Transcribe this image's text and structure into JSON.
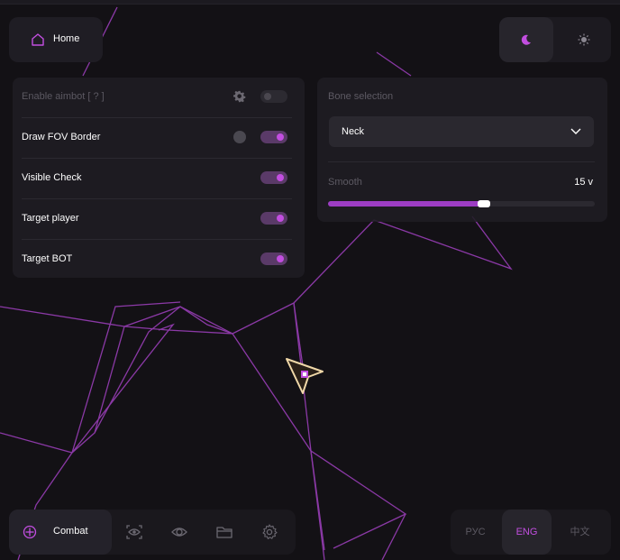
{
  "colors": {
    "accent": "#c24ee0",
    "background": "#131115",
    "panel": "#1f1d23"
  },
  "header": {
    "home_label": "Home",
    "home_icon": "home-icon",
    "theme_icons": [
      "moon-icon",
      "sun-icon"
    ],
    "active_theme": "dark"
  },
  "aimbot_panel": {
    "rows": [
      {
        "label": "Enable aimbot  [ ? ]",
        "enabled": false,
        "has_settings": true
      },
      {
        "label": "Draw FOV Border",
        "enabled": true,
        "has_color": true
      },
      {
        "label": "Visible Check",
        "enabled": true
      },
      {
        "label": "Target player",
        "enabled": true
      },
      {
        "label": "Target BOT",
        "enabled": true
      }
    ]
  },
  "bone_panel": {
    "title": "Bone selection",
    "selected": "Neck",
    "smooth_label": "Smooth",
    "smooth_value": "15 v",
    "smooth_fraction": 0.58
  },
  "bottom_nav": {
    "active_label": "Combat",
    "icons": [
      "crosshair-icon",
      "eye-scan-icon",
      "eye-icon",
      "folder-icon",
      "gear-icon"
    ]
  },
  "languages": {
    "items": [
      "РУС",
      "ENG",
      "中文"
    ],
    "active": "ENG"
  }
}
